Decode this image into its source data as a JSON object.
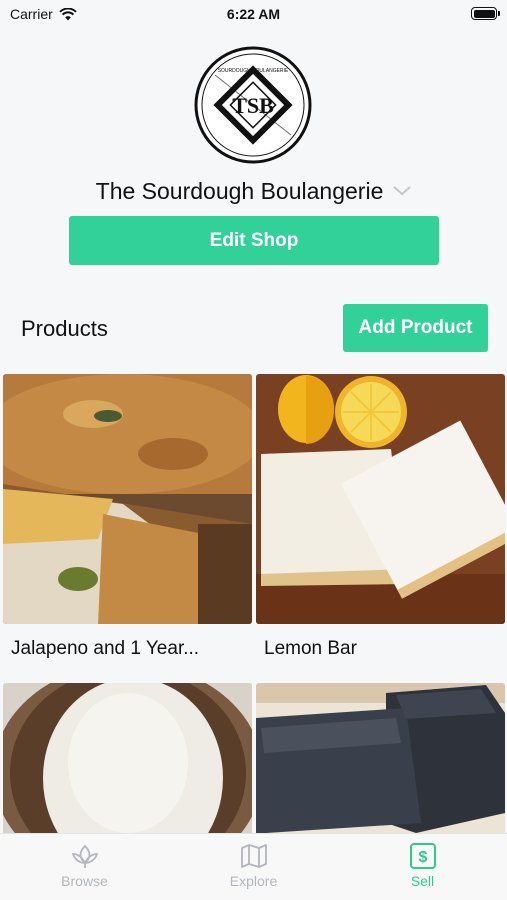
{
  "status_bar": {
    "carrier": "Carrier",
    "time": "6:22 AM"
  },
  "shop": {
    "name": "The Sourdough Boulangerie",
    "logo_initials": "TSB",
    "logo_text_top": "SOURDOUGH BOULANGERIE",
    "edit_label": "Edit Shop"
  },
  "products": {
    "heading": "Products",
    "add_label": "Add Product",
    "items": [
      {
        "name": "Jalapeno and 1 Year...",
        "image": "jalapeno-bread-photo"
      },
      {
        "name": "Lemon Bar",
        "image": "lemon-bar-photo"
      },
      {
        "name": "",
        "image": "floured-loaf-photo"
      },
      {
        "name": "",
        "image": "charcoal-bread-photo"
      }
    ]
  },
  "tab_bar": {
    "items": [
      {
        "label": "Browse",
        "icon": "leaf-icon",
        "active": false
      },
      {
        "label": "Explore",
        "icon": "map-icon",
        "active": false
      },
      {
        "label": "Sell",
        "icon": "dollar-icon",
        "active": true
      }
    ]
  },
  "colors": {
    "accent": "#33d19a",
    "tab_inactive": "#b3b6bb",
    "background": "#f6f7f9"
  }
}
